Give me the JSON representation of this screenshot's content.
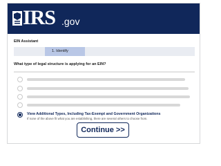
{
  "header": {
    "logo_text": "IRS",
    "logo_domain": ".gov",
    "logo_icon": "eagle-seal-icon"
  },
  "assistant_title": "EIN Assistant",
  "progress": {
    "step_label": "1. Identify"
  },
  "question": "What type of legal structure is applying for an EIN?",
  "options": [
    {
      "selected": false
    },
    {
      "selected": false
    },
    {
      "selected": false
    },
    {
      "selected": false
    },
    {
      "selected": true,
      "label": "View Additional Types, Including Tax-Exempt and Government Organizations",
      "description": "If none of the above fit what you are establishing, there are several others to choose from."
    }
  ],
  "continue_label": "Continue >>",
  "colors": {
    "brand_navy": "#10275a",
    "progress_active": "#b9c7e6"
  }
}
